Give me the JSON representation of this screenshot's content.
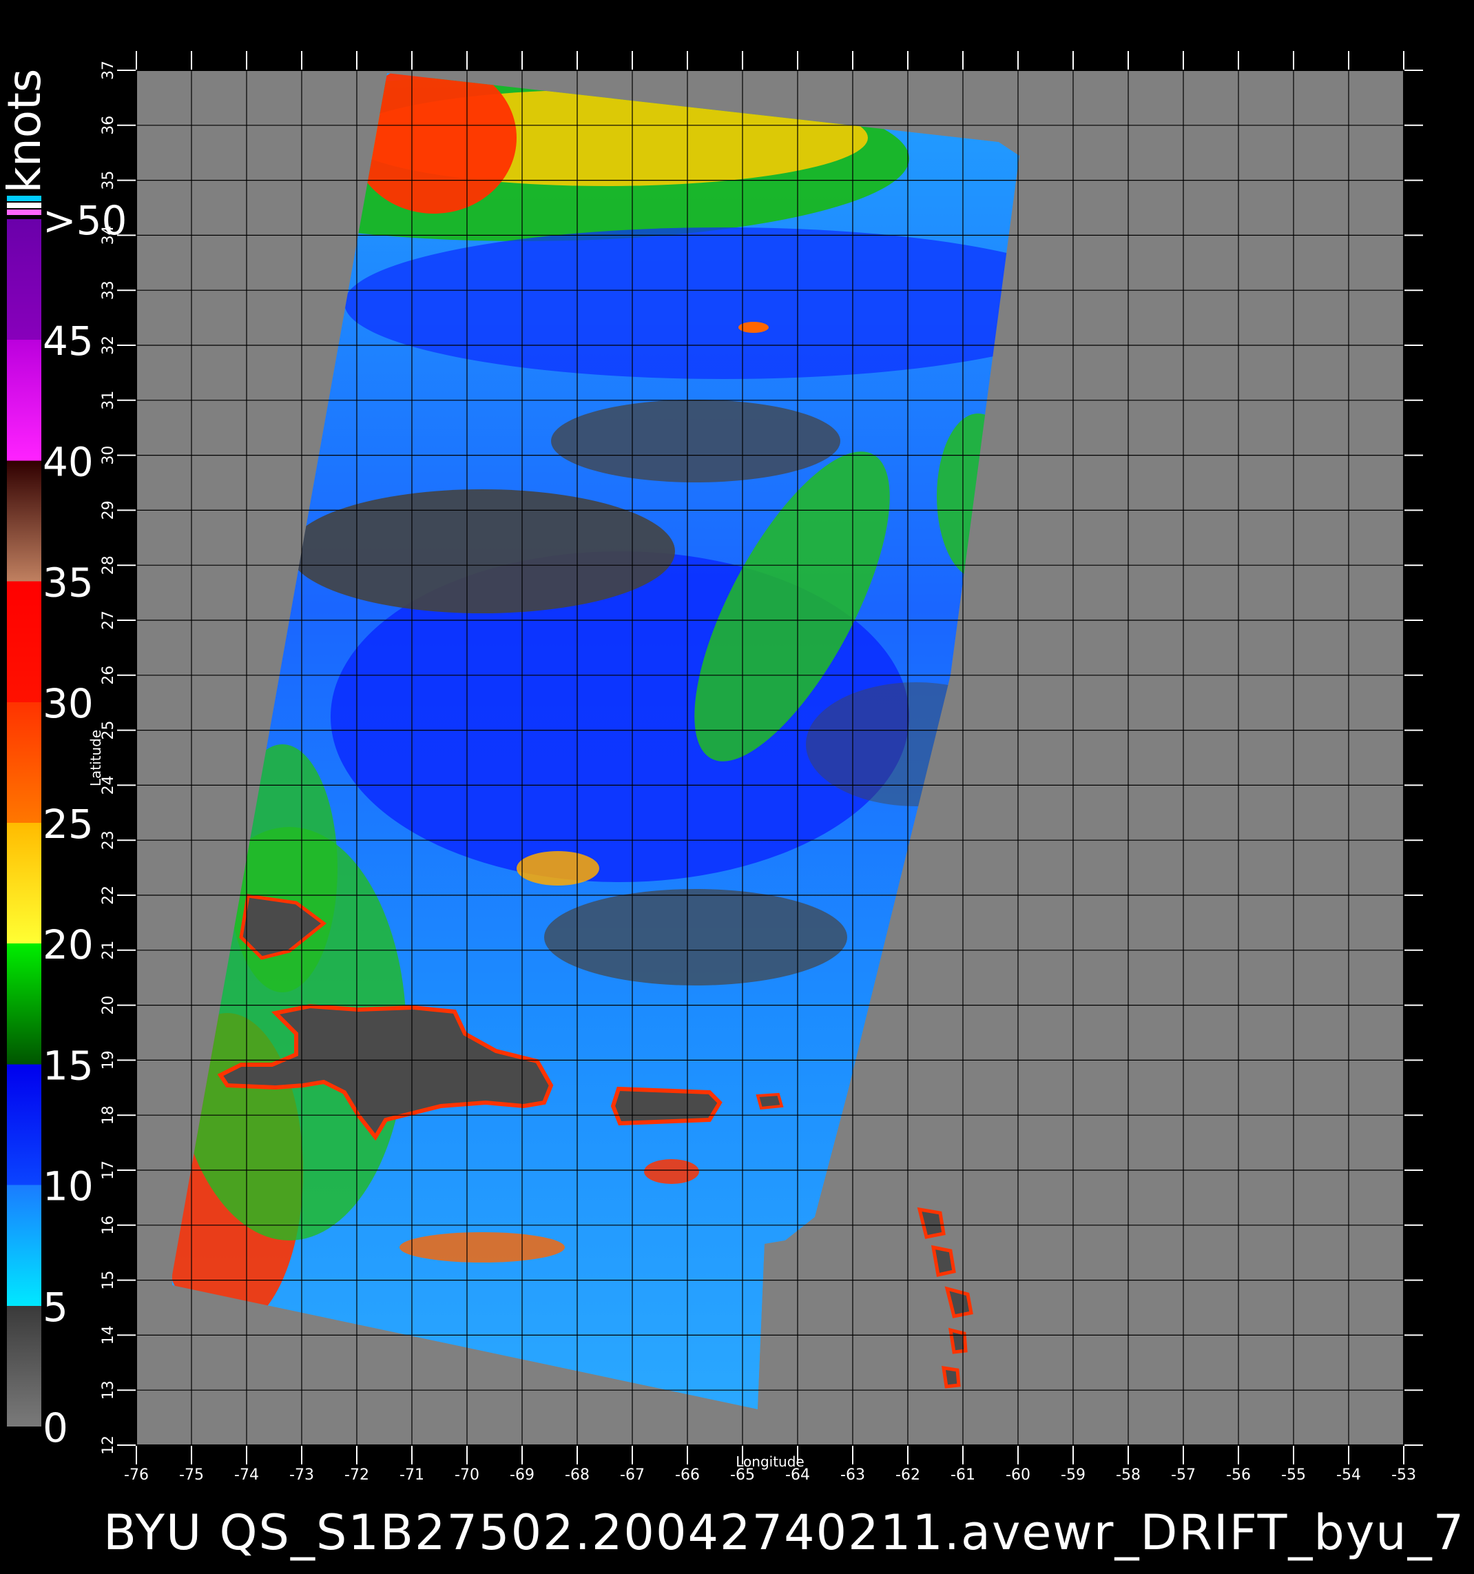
{
  "map": {
    "x_axis_label": "Longitude",
    "y_axis_label": "Latitude",
    "lon_range": [
      -76,
      -53
    ],
    "lat_range": [
      12,
      37
    ],
    "x_ticks": [
      "-76",
      "-75",
      "-74",
      "-73",
      "-72",
      "-71",
      "-70",
      "-69",
      "-68",
      "-67",
      "-66",
      "-65",
      "-64",
      "-63",
      "-62",
      "-61",
      "-60",
      "-59",
      "-58",
      "-57",
      "-56",
      "-55",
      "-54",
      "-53"
    ],
    "y_ticks": [
      "12",
      "13",
      "14",
      "15",
      "16",
      "17",
      "18",
      "19",
      "20",
      "21",
      "22",
      "23",
      "24",
      "25",
      "26",
      "27",
      "28",
      "29",
      "30",
      "31",
      "32",
      "33",
      "34",
      "35",
      "36",
      "37"
    ],
    "background_color": "#808080",
    "land_color": "#4a4a4a",
    "grid_color": "#000000"
  },
  "legend": {
    "unit": "knots",
    "labels": [
      "0",
      "5",
      "10",
      "15",
      "20",
      "25",
      "30",
      "35",
      "40",
      "45",
      ">50"
    ],
    "colors": {
      "0_5": "#707070",
      "5_10": "#1ea0ff",
      "10_15": "#0022ff",
      "15_20": "#00bb00",
      "20_25": "#ffdd00",
      "25_30": "#ff5500",
      "30_35": "#ff1100",
      "35_40": "#6b3020",
      "40_45": "#ff00ff",
      "45_50": "#8a10cc"
    }
  },
  "footer": {
    "title": "BYU  QS_S1B27502.20042740211.avewr_DRIFT_byu_7"
  }
}
